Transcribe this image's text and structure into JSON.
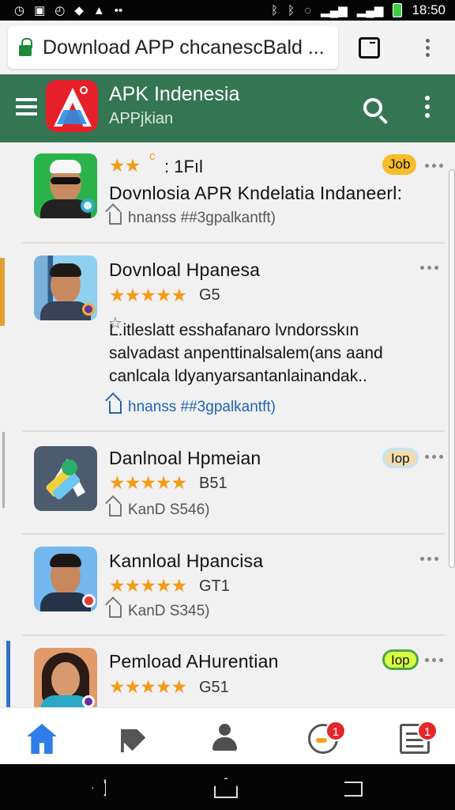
{
  "status_bar": {
    "time": "18:50",
    "left_icons": [
      "alarm-icon",
      "screen-icon",
      "clock-icon",
      "pinwheel-icon",
      "shield-icon",
      "more-dots-icon"
    ],
    "right_icons": [
      "bluetooth-icon",
      "bluetooth-off-icon",
      "dnd-icon",
      "signal-icon",
      "signal-icon",
      "battery-icon"
    ]
  },
  "browser": {
    "url_text": "Download APP chcanescBald ...",
    "icons": [
      "lock-icon",
      "tab-switcher-icon",
      "more-vertical-icon"
    ]
  },
  "app_bar": {
    "title": "APK Indenesia",
    "subtitle": "APPjkian",
    "icons": [
      "menu-icon",
      "search-icon",
      "more-vertical-icon"
    ]
  },
  "apps": [
    {
      "title": "Dovnlosia APR Kndelatia Indaneerl:",
      "rating": ": 1Fıl",
      "rating_stars": 1.5,
      "meta": "hnanss ##3gpalkantft)",
      "badge": "Job"
    },
    {
      "title": "Dovnloal Hpanesa",
      "rating": "G5",
      "rating_stars": 5,
      "description": "L.itleslatt esshafanaro lvndorsskın salvadast anpenttinalsalem(ans aand canlcala ldyanyarsantanlainandak..",
      "link": "hnanss ##3gpalkantft)"
    },
    {
      "title": "Danlnoal Hpmeian",
      "rating": "B51",
      "rating_stars": 5,
      "meta": "KanD S546)",
      "badge": "Iop"
    },
    {
      "title": "Kannloal Hpancisa",
      "rating": "GT1",
      "rating_stars": 5,
      "meta": "KanD S345)"
    },
    {
      "title": "Pemload AHurentian",
      "rating": "G51",
      "rating_stars": 5,
      "badge": "Iop"
    }
  ],
  "bottom_nav": {
    "items": [
      {
        "icon": "home-icon",
        "active": true
      },
      {
        "icon": "tag-heart-icon"
      },
      {
        "icon": "profile-icon"
      },
      {
        "icon": "chat-icon",
        "badge": "1"
      },
      {
        "icon": "list-icon",
        "badge": "1"
      }
    ]
  },
  "colors": {
    "accent": "#347554",
    "star": "#f39b16",
    "badge": "#f6bd29",
    "link": "#1f63b5",
    "notification": "#e3272d"
  }
}
